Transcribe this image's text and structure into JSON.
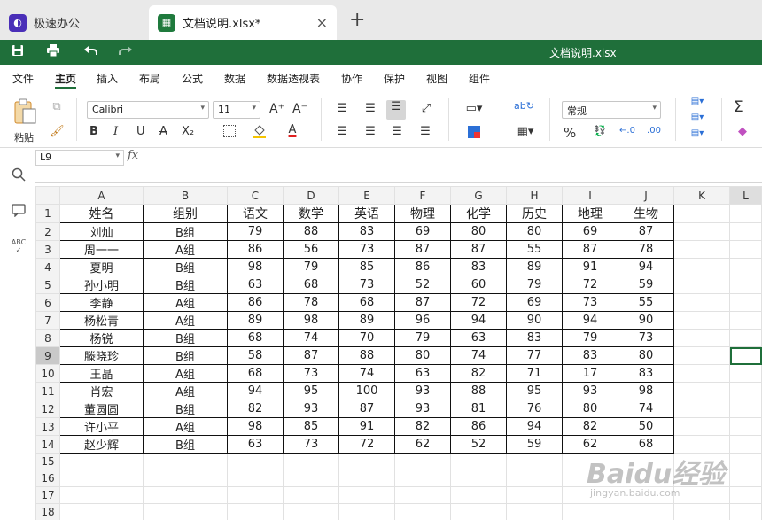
{
  "tabs": {
    "home_label": "极速办公",
    "doc_label": "文档说明.xlsx*",
    "close_glyph": "×",
    "new_glyph": "+"
  },
  "quickbar": {
    "doc_title": "文档说明.xlsx"
  },
  "menu": {
    "items": [
      "文件",
      "主页",
      "插入",
      "布局",
      "公式",
      "数据",
      "数据透视表",
      "协作",
      "保护",
      "视图",
      "组件"
    ],
    "active": "主页"
  },
  "ribbon": {
    "paste_label": "粘贴",
    "font_name": "Calibri",
    "font_size": "11",
    "number_format": "常规",
    "bold": "B",
    "italic": "I",
    "underline": "U",
    "strike": "A",
    "subscript": "X₂",
    "grow_font": "A⁺",
    "shrink_font": "A⁻",
    "font_color_glyph": "A",
    "percent": "%",
    "sum": "Σ"
  },
  "formula_bar": {
    "name_box": "L9",
    "fx": "fx"
  },
  "sheet": {
    "columns": [
      "A",
      "B",
      "C",
      "D",
      "E",
      "F",
      "G",
      "H",
      "I",
      "J",
      "K",
      "L"
    ],
    "active_column": "L",
    "active_row": 9,
    "row_count": 19,
    "header": [
      "姓名",
      "组别",
      "语文",
      "数学",
      "英语",
      "物理",
      "化学",
      "历史",
      "地理",
      "生物"
    ],
    "rows": [
      [
        "刘灿",
        "B组",
        "79",
        "88",
        "83",
        "69",
        "80",
        "80",
        "69",
        "87"
      ],
      [
        "周一一",
        "A组",
        "86",
        "56",
        "73",
        "87",
        "87",
        "55",
        "87",
        "78"
      ],
      [
        "夏明",
        "B组",
        "98",
        "79",
        "85",
        "86",
        "83",
        "89",
        "91",
        "94"
      ],
      [
        "孙小明",
        "B组",
        "63",
        "68",
        "73",
        "52",
        "60",
        "79",
        "72",
        "59"
      ],
      [
        "李静",
        "A组",
        "86",
        "78",
        "68",
        "87",
        "72",
        "69",
        "73",
        "55"
      ],
      [
        "杨松青",
        "A组",
        "89",
        "98",
        "89",
        "96",
        "94",
        "90",
        "94",
        "90"
      ],
      [
        "杨锐",
        "B组",
        "68",
        "74",
        "70",
        "79",
        "63",
        "83",
        "79",
        "73"
      ],
      [
        "滕晓珍",
        "B组",
        "58",
        "87",
        "88",
        "80",
        "74",
        "77",
        "83",
        "80"
      ],
      [
        "王晶",
        "A组",
        "68",
        "73",
        "74",
        "63",
        "82",
        "71",
        "17",
        "83"
      ],
      [
        "肖宏",
        "A组",
        "94",
        "95",
        "100",
        "93",
        "88",
        "95",
        "93",
        "98"
      ],
      [
        "董圆圆",
        "B组",
        "82",
        "93",
        "87",
        "93",
        "81",
        "76",
        "80",
        "74"
      ],
      [
        "许小平",
        "A组",
        "98",
        "85",
        "91",
        "82",
        "86",
        "94",
        "82",
        "50"
      ],
      [
        "赵少辉",
        "B组",
        "63",
        "73",
        "72",
        "62",
        "52",
        "59",
        "62",
        "68"
      ]
    ]
  },
  "watermark": {
    "brand": "Baidu经验",
    "url": "jingyan.baidu.com"
  }
}
